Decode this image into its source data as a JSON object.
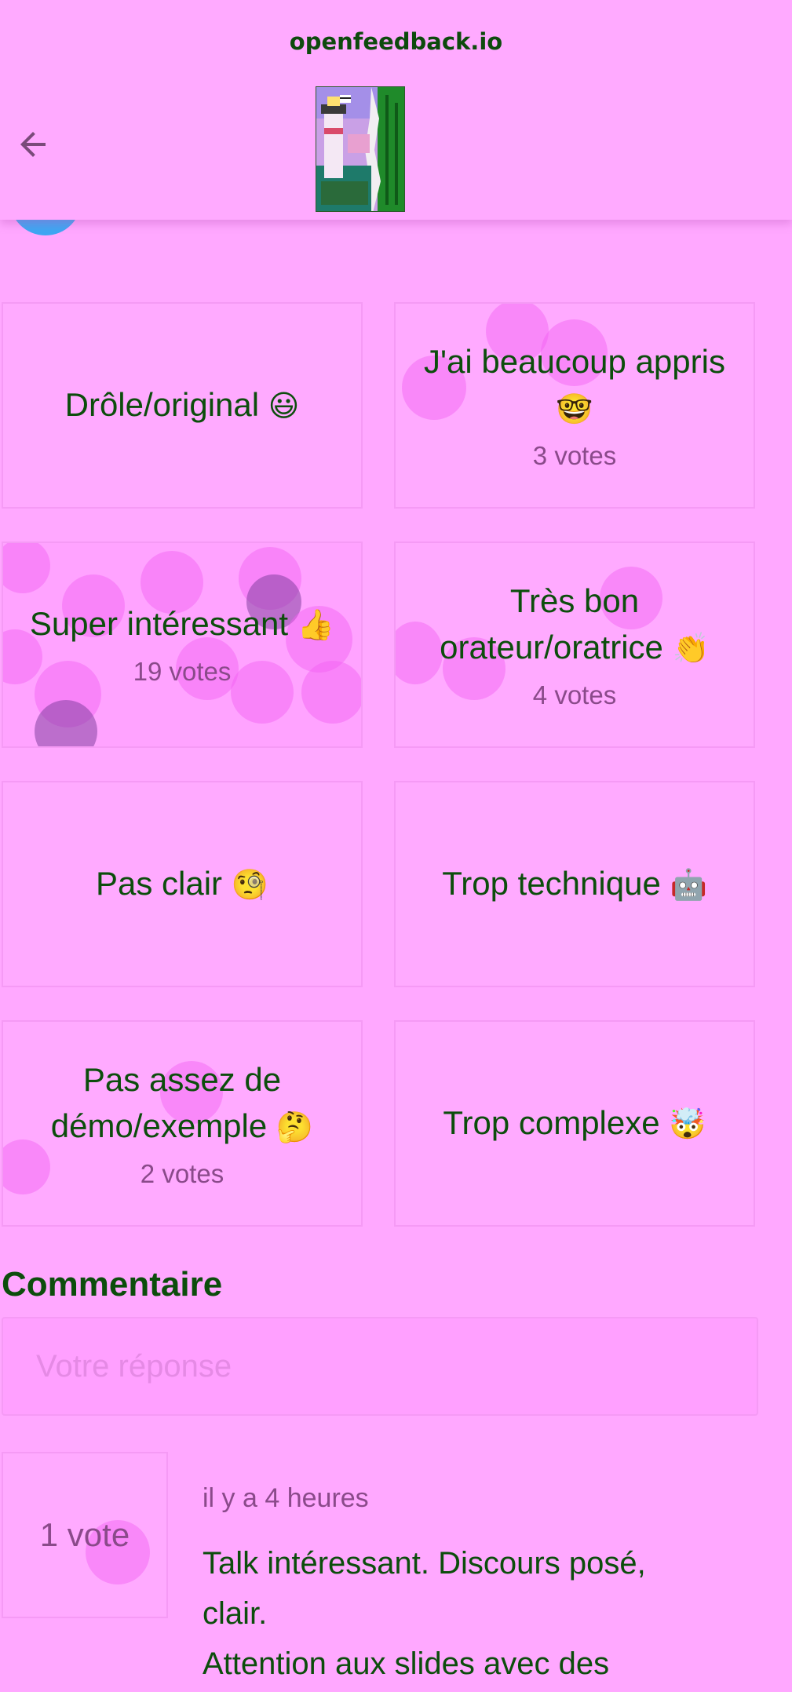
{
  "header": {
    "site_url": "openfeedback.io"
  },
  "reactions": [
    {
      "label": "Drôle/original",
      "emoji": "😃",
      "votes": ""
    },
    {
      "label": "J'ai beaucoup appris",
      "emoji": "🤓",
      "votes": "3 votes"
    },
    {
      "label": "Super intéressant",
      "emoji": "👍",
      "votes": "19 votes"
    },
    {
      "label": "Très bon orateur/oratrice",
      "emoji": "👏",
      "votes": "4 votes"
    },
    {
      "label": "Pas clair",
      "emoji": "🧐",
      "votes": ""
    },
    {
      "label": "Trop technique",
      "emoji": "🤖",
      "votes": ""
    },
    {
      "label": "Pas assez de démo/exemple",
      "emoji": "🤔",
      "votes": "2 votes"
    },
    {
      "label": "Trop complexe",
      "emoji": "🤯",
      "votes": ""
    }
  ],
  "comments": {
    "title": "Commentaire",
    "placeholder": "Votre réponse",
    "items": [
      {
        "votes": "1 vote",
        "time": "il y a 4 heures",
        "line1": "Talk intéressant. Discours posé,",
        "line2": "clair.",
        "line3": "Attention aux slides avec des"
      }
    ]
  },
  "colors": {
    "background": "#ffa8ff",
    "text_green": "#0c4d0c",
    "muted": "#8a4a8a",
    "avatar_blue": "#3ea6f2"
  }
}
